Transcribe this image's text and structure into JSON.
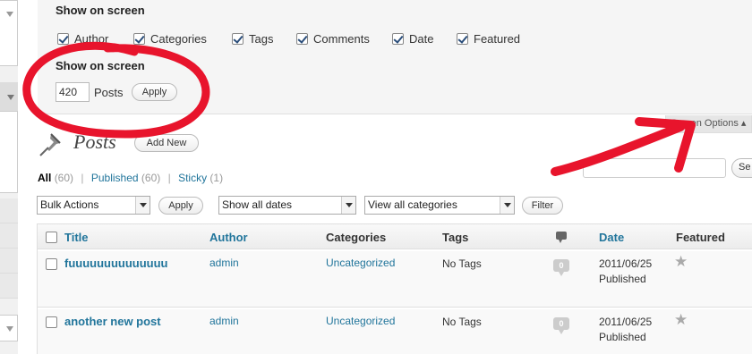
{
  "screen_options": {
    "columns_heading": "Show on screen",
    "columns": [
      {
        "label": "Author",
        "checked": true
      },
      {
        "label": "Categories",
        "checked": true
      },
      {
        "label": "Tags",
        "checked": true
      },
      {
        "label": "Comments",
        "checked": true
      },
      {
        "label": "Date",
        "checked": true
      },
      {
        "label": "Featured",
        "checked": true
      }
    ],
    "per_page_heading": "Show on screen",
    "per_page_value": "420",
    "per_page_label": "Posts",
    "apply_label": "Apply"
  },
  "screen_options_tab": {
    "label": "Screen Options ▴"
  },
  "page": {
    "title": "Posts",
    "add_new_label": "Add New"
  },
  "status_links": {
    "all": {
      "label": "All",
      "count": "(60)"
    },
    "published": {
      "label": "Published",
      "count": "(60)"
    },
    "sticky": {
      "label": "Sticky",
      "count": "(1)"
    },
    "separator": "|"
  },
  "search": {
    "button_label": "Se"
  },
  "filters": {
    "bulk_actions": "Bulk Actions",
    "apply_label": "Apply",
    "dates": "Show all dates",
    "categories": "View all categories",
    "filter_label": "Filter"
  },
  "table": {
    "headers": {
      "title": "Title",
      "author": "Author",
      "categories": "Categories",
      "tags": "Tags",
      "date": "Date",
      "featured": "Featured"
    },
    "rows": [
      {
        "title": "fuuuuuuuuuuuuuu",
        "author": "admin",
        "category": "Uncategorized",
        "tags": "No Tags",
        "comments": "0",
        "date": "2011/06/25",
        "status": "Published"
      },
      {
        "title": "another new post",
        "author": "admin",
        "category": "Uncategorized",
        "tags": "No Tags",
        "comments": "0",
        "date": "2011/06/25",
        "status": "Published"
      }
    ]
  },
  "colors": {
    "annotation_red": "#e8142c",
    "link_blue": "#21759b"
  },
  "icons": [
    "posts-pushpin-icon",
    "comment-bubble-icon",
    "star-icon",
    "dropdown-arrow-icon",
    "checkmark-icon"
  ]
}
